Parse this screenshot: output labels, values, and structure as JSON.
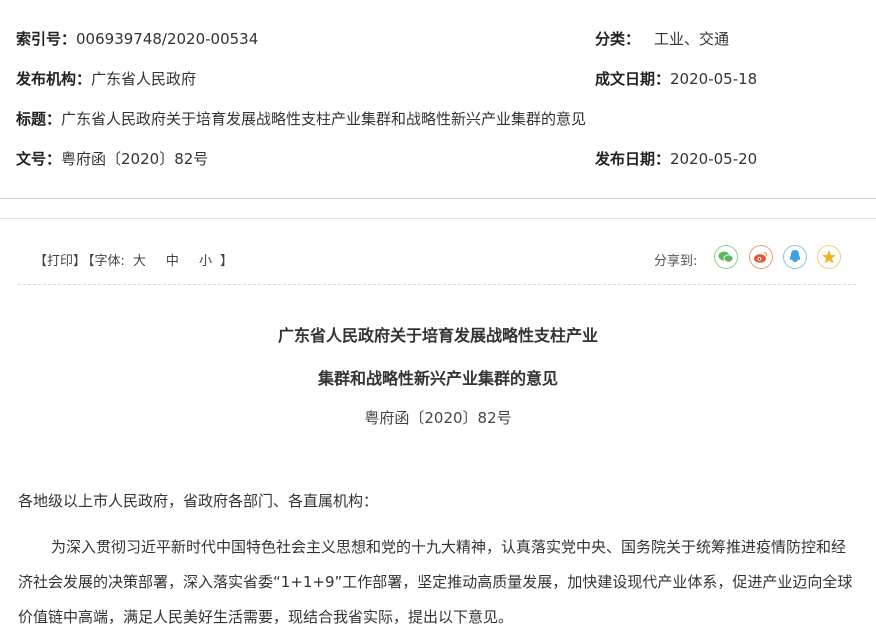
{
  "meta": {
    "index_label": "索引号：",
    "index_value": "006939748/2020-00534",
    "category_label": "分类：",
    "category_value": "工业、交通",
    "publisher_label": "发布机构：",
    "publisher_value": "广东省人民政府",
    "written_date_label": "成文日期：",
    "written_date_value": "2020-05-18",
    "title_label": "标题：",
    "title_value": "广东省人民政府关于培育发展战略性支柱产业集群和战略性新兴产业集群的意见",
    "docnum_label": "文号：",
    "docnum_value": "粤府函〔2020〕82号",
    "pub_date_label": "发布日期：",
    "pub_date_value": "2020-05-20"
  },
  "toolbar": {
    "print": "【打印】",
    "font_prefix": "【字体:",
    "font_large": "大",
    "font_medium": "中",
    "font_small": "小",
    "font_suffix": "】",
    "share_label": "分享到:"
  },
  "share_icons": [
    {
      "name": "wechat-icon",
      "color": "#5cb85c"
    },
    {
      "name": "weibo-icon",
      "color": "#e05a3a"
    },
    {
      "name": "qq-icon",
      "color": "#3aa3e0"
    },
    {
      "name": "qzone-icon",
      "color": "#f0b323"
    }
  ],
  "article": {
    "title_line1": "广东省人民政府关于培育发展战略性支柱产业",
    "title_line2": "集群和战略性新兴产业集群的意见",
    "docnum": "粤府函〔2020〕82号",
    "addressee": "各地级以上市人民政府，省政府各部门、各直属机构：",
    "paragraph1": "为深入贯彻习近平新时代中国特色社会主义思想和党的十九大精神，认真落实党中央、国务院关于统筹推进疫情防控和经济社会发展的决策部署，深入落实省委“1+1+9”工作部署，坚定推动高质量发展，加快建设现代产业体系，促进产业迈向全球价值链中高端，满足人民美好生活需要，现结合我省实际，提出以下意见。"
  }
}
